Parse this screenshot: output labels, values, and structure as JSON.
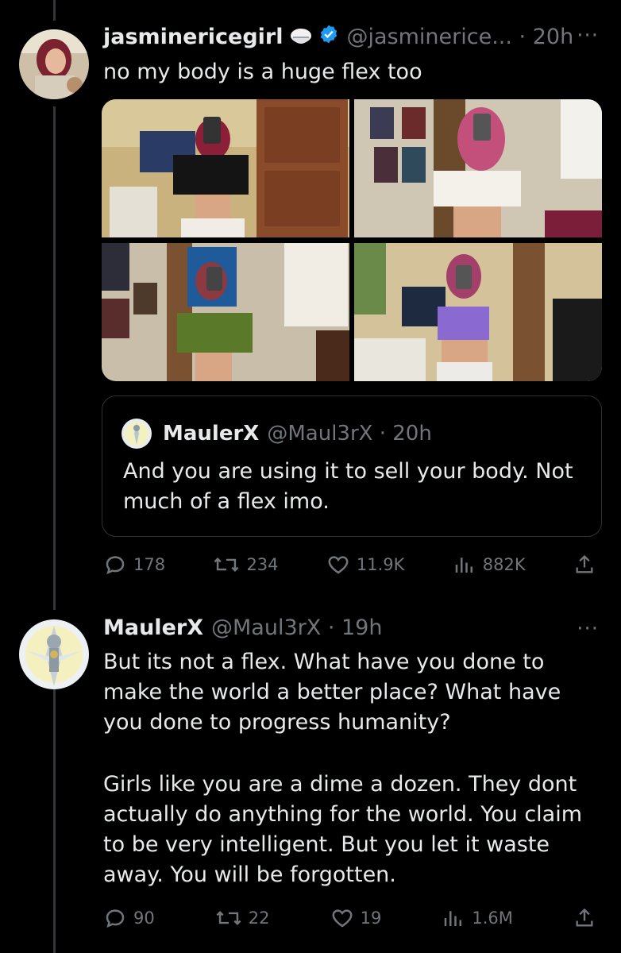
{
  "tweet": {
    "display_name": "jasminericegirl",
    "handle_time": "@jasminerice... · 20h",
    "text": "no my body is a huge flex too",
    "stats": {
      "replies": "178",
      "retweets": "234",
      "likes": "11.9K",
      "views": "882K"
    },
    "quote": {
      "display_name": "MaulerX",
      "handle_time": "@Maul3rX · 20h",
      "text": "And you are using it to sell your body. Not much of a flex imo."
    }
  },
  "reply": {
    "display_name": "MaulerX",
    "handle_time": "@Maul3rX · 19h",
    "paragraph1": "But its not a flex. What have you done to make the world a better place? What have you done to progress humanity?",
    "paragraph2": "Girls like you are a dime a dozen. They dont actually do anything for the world. You claim to be very intelligent. But you let it waste away. You will be forgotten.",
    "stats": {
      "replies": "90",
      "retweets": "22",
      "likes": "19",
      "views": "1.6M"
    }
  },
  "colors": {
    "background": "#000000",
    "muted": "#71767b",
    "verified": "#1d9bf0"
  }
}
